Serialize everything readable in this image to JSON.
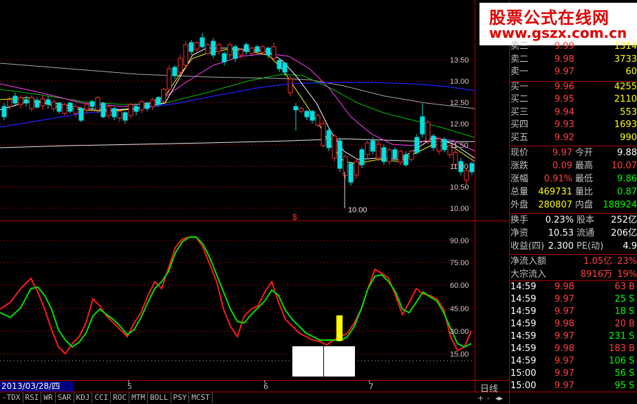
{
  "brand": {
    "title": "股票公式在线网",
    "url": "www.gszx.com.cn"
  },
  "price_axis": [
    "13.50",
    "13.00",
    "12.50",
    "12.00",
    "11.50",
    "11.00",
    "10.50",
    "10.00"
  ],
  "osc_axis": [
    "90.00",
    "75.00",
    "60.00",
    "45.00",
    "30.00",
    "15.00"
  ],
  "annotations": {
    "low_label": "10.00",
    "dollar_marker": "$",
    "date": "2013/03/28/四",
    "x_ticks": [
      "5",
      "6",
      "7"
    ]
  },
  "indicator_tabs": [
    "-TDX",
    "RSI",
    "WR",
    "SAR",
    "KDJ",
    "CCI",
    "ROC",
    "MTM",
    "BOLL",
    "PSY",
    "MCST"
  ],
  "footer": {
    "period": "日线",
    "plus": "+",
    "minus": "-",
    "arrows": "◂▸"
  },
  "order_book": [
    {
      "label": "卖三",
      "price": "9.99",
      "vol": "1314"
    },
    {
      "label": "卖二",
      "price": "9.98",
      "vol": "3733"
    },
    {
      "label": "卖一",
      "price": "9.97",
      "vol": "60"
    },
    {
      "label": "买一",
      "price": "9.96",
      "vol": "4255"
    },
    {
      "label": "买二",
      "price": "9.95",
      "vol": "2110"
    },
    {
      "label": "买三",
      "price": "9.94",
      "vol": "553"
    },
    {
      "label": "买四",
      "price": "9.93",
      "vol": "1693"
    },
    {
      "label": "买五",
      "price": "9.92",
      "vol": "990"
    }
  ],
  "stats": [
    {
      "l1": "现价",
      "v1": "9.97",
      "l2": "今开",
      "v2": "9.88"
    },
    {
      "l1": "涨跌",
      "v1": "0.09",
      "l2": "最高",
      "v2": "10.07"
    },
    {
      "l1": "涨幅",
      "v1": "0.91%",
      "l2": "最低",
      "v2": "9.86"
    },
    {
      "l1": "总量",
      "v1": "469731",
      "l2": "量比",
      "v2": "0.87"
    },
    {
      "l1": "外盘",
      "v1": "280807",
      "l2": "内盘",
      "v2": "188924"
    }
  ],
  "finance": [
    {
      "l1": "换手",
      "v1": "0.23%",
      "l2": "股本",
      "v2": "252亿"
    },
    {
      "l1": "净资",
      "v1": "10.53",
      "l2": "流通",
      "v2": "206亿"
    },
    {
      "l1": "收益(四)",
      "v1": "2.300",
      "l2": "PE(动)",
      "v2": "4.9"
    }
  ],
  "flows": [
    {
      "label": "净流入额",
      "value": "1.05亿",
      "pct": "23%"
    },
    {
      "label": "大宗流入",
      "value": "8916万",
      "pct": "19%"
    }
  ],
  "ticks": [
    {
      "time": "14:59",
      "price": "9.98",
      "vol": "63",
      "side": "B"
    },
    {
      "time": "14:59",
      "price": "9.97",
      "vol": "25",
      "side": "S"
    },
    {
      "time": "14:59",
      "price": "9.97",
      "vol": "18",
      "side": "S"
    },
    {
      "time": "14:59",
      "price": "9.98",
      "vol": "20",
      "side": "B"
    },
    {
      "time": "14:59",
      "price": "9.97",
      "vol": "231",
      "side": "S"
    },
    {
      "time": "14:59",
      "price": "9.98",
      "vol": "183",
      "side": "B"
    },
    {
      "time": "14:59",
      "price": "9.97",
      "vol": "106",
      "side": "S"
    },
    {
      "time": "15:00",
      "price": "9.97",
      "vol": "56",
      "side": "S"
    },
    {
      "time": "15:00",
      "price": "9.97",
      "vol": "95",
      "side": "S"
    }
  ]
}
